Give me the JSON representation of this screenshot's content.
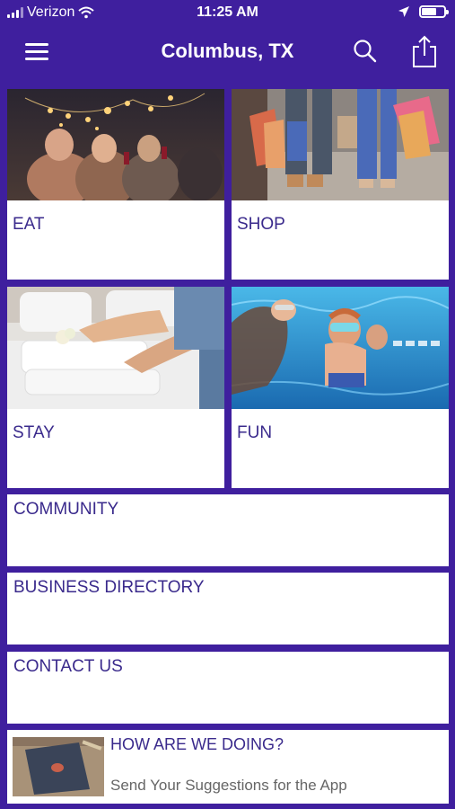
{
  "status_bar": {
    "carrier": "Verizon",
    "time": "11:25 AM"
  },
  "nav": {
    "title": "Columbus, TX",
    "icons": [
      "menu-icon",
      "search-icon",
      "share-icon"
    ]
  },
  "tiles": {
    "eat": "EAT",
    "shop": "SHOP",
    "stay": "STAY",
    "fun": "FUN"
  },
  "sections": {
    "community": "COMMUNITY",
    "business_directory": "BUSINESS DIRECTORY",
    "contact_us": "CONTACT US"
  },
  "feedback": {
    "title": "HOW ARE WE DOING?",
    "subtitle": "Send Your Suggestions for the App"
  },
  "colors": {
    "background": "#3f1f9e",
    "label_text": "#3a2a8c",
    "tile_background": "#ffffff"
  }
}
